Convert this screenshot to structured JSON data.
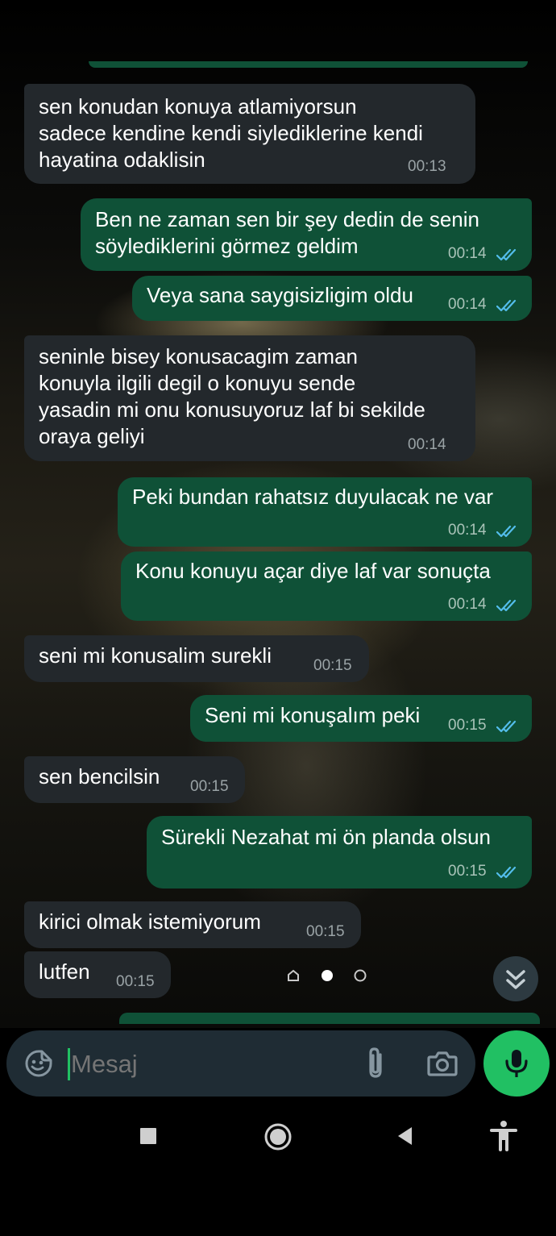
{
  "messages": [
    {
      "dir": "in",
      "text": "sen konudan konuya atlamiyorsun\nsadece kendine kendi siylediklerine kendi\nhayatina odaklisin",
      "time": "00:13"
    },
    {
      "dir": "out",
      "text": "Ben ne zaman sen bir şey dedin de senin\nsöylediklerini görmez geldim",
      "time": "00:14",
      "status": "read"
    },
    {
      "dir": "out",
      "text": "Veya sana saygisizligim oldu",
      "time": "00:14",
      "status": "read"
    },
    {
      "dir": "in",
      "text": "seninle bisey konusacagim zaman\nkonuyla ilgili degil o konuyu sende\nyasadin mi onu konusuyoruz laf bi sekilde\noraya geliyi",
      "time": "00:14"
    },
    {
      "dir": "out",
      "text": "Peki bundan rahatsız duyulacak ne var",
      "time": "00:14",
      "status": "read"
    },
    {
      "dir": "out",
      "text": "Konu konuyu açar diye laf var sonuçta",
      "time": "00:14",
      "status": "read"
    },
    {
      "dir": "in",
      "text": "seni mi konusalim surekli",
      "time": "00:15"
    },
    {
      "dir": "out",
      "text": "Seni mi konuşalım peki",
      "time": "00:15",
      "status": "read"
    },
    {
      "dir": "in",
      "text": "sen bencilsin",
      "time": "00:15"
    },
    {
      "dir": "out",
      "text": "Sürekli Nezahat mi ön planda olsun",
      "time": "00:15",
      "status": "read"
    },
    {
      "dir": "in",
      "text": "kirici olmak istemiyorum",
      "time": "00:15"
    },
    {
      "dir": "in",
      "text": "lutfen",
      "time": "00:15"
    }
  ],
  "composer": {
    "placeholder": "Mesaj",
    "emoji_icon": "sticker-smile-icon",
    "attach_icon": "paperclip-icon",
    "camera_icon": "camera-icon",
    "mic_icon": "microphone-icon"
  },
  "scroll_button_icon": "double-chevron-down-icon",
  "navbar": {
    "icons": [
      "square-recents-icon",
      "circle-home-icon",
      "triangle-back-icon",
      "accessibility-icon"
    ]
  },
  "colors": {
    "incoming_bubble": "#23282c",
    "outgoing_bubble": "#0f5137",
    "read_ticks": "#53bdeb",
    "accent": "#21c063",
    "composer_bg": "#1f2c34"
  }
}
